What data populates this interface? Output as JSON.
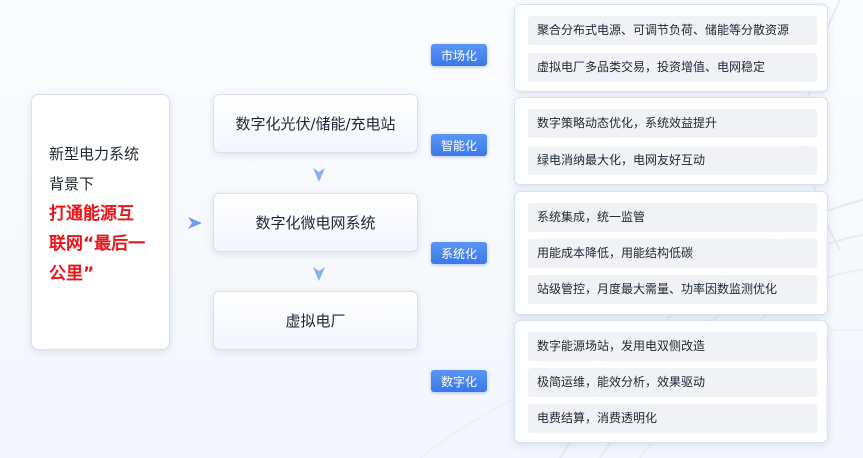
{
  "left": {
    "line1": "新型电力系统",
    "line2": "背景下",
    "line3": "打通能源互",
    "line4": "联网“最后一",
    "line5": "公里”"
  },
  "middle": {
    "box1": "数字化光伏/储能/充电站",
    "box2": "数字化微电网系统",
    "box3": "虚拟电厂"
  },
  "tags": {
    "market": "市场化",
    "smart": "智能化",
    "system": "系统化",
    "digital": "数字化"
  },
  "groups": {
    "market": [
      "聚合分布式电源、可调节负荷、储能等分散资源",
      "虚拟电厂多品类交易，投资增值、电网稳定"
    ],
    "smart": [
      "数字策略动态优化，系统效益提升",
      "绿电消纳最大化，电网友好互动"
    ],
    "system": [
      "系统集成，统一监管",
      "用能成本降低，用能结构低碳",
      "站级管控，月度最大需量、功率因数监测优化"
    ],
    "digital": [
      "数字能源场站，发用电双侧改造",
      "极简运维，能效分析，效果驱动",
      "电费结算，消费透明化"
    ]
  },
  "colors": {
    "accent": "#3c78e6",
    "highlight": "#e8151a",
    "arrow": "#6f9df0"
  }
}
